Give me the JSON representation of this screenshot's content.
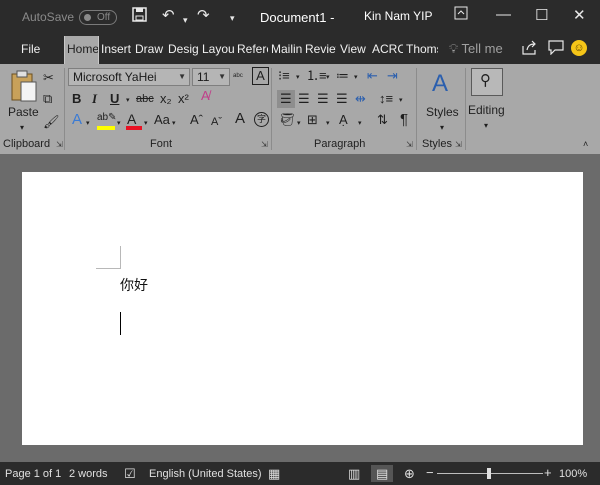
{
  "titlebar": {
    "autosave_label": "AutoSave",
    "autosave_state": "Off",
    "document_title": "Document1  -",
    "user_name": "Kin Nam YIP"
  },
  "tabs": [
    {
      "label": "File"
    },
    {
      "label": "Home"
    },
    {
      "label": "Insert"
    },
    {
      "label": "Draw"
    },
    {
      "label": "Design"
    },
    {
      "label": "Layout"
    },
    {
      "label": "References"
    },
    {
      "label": "Mailings"
    },
    {
      "label": "Review"
    },
    {
      "label": "View"
    },
    {
      "label": "ACRC"
    },
    {
      "label": "Thomson"
    }
  ],
  "tell_me": "Tell me",
  "ribbon": {
    "clipboard": {
      "paste_label": "Paste",
      "group_label": "Clipboard"
    },
    "font": {
      "font_name": "Microsoft YaHei",
      "font_size": "11",
      "group_label": "Font"
    },
    "paragraph": {
      "group_label": "Paragraph"
    },
    "styles": {
      "styles_label": "Styles",
      "group_label": "Styles"
    },
    "editing": {
      "editing_label": "Editing"
    }
  },
  "document": {
    "text": "你好"
  },
  "statusbar": {
    "page": "Page 1 of 1",
    "words": "2 words",
    "language": "English (United States)",
    "zoom": "100%",
    "zoom_minus": "−",
    "zoom_plus": "+"
  },
  "colors": {
    "titlebar_bg": "#2b2b2b",
    "ribbon_bg": "#a8a8a8",
    "canvas_bg": "#6b6b6b",
    "highlight": "#ffff00",
    "font_color": "#e81123"
  }
}
